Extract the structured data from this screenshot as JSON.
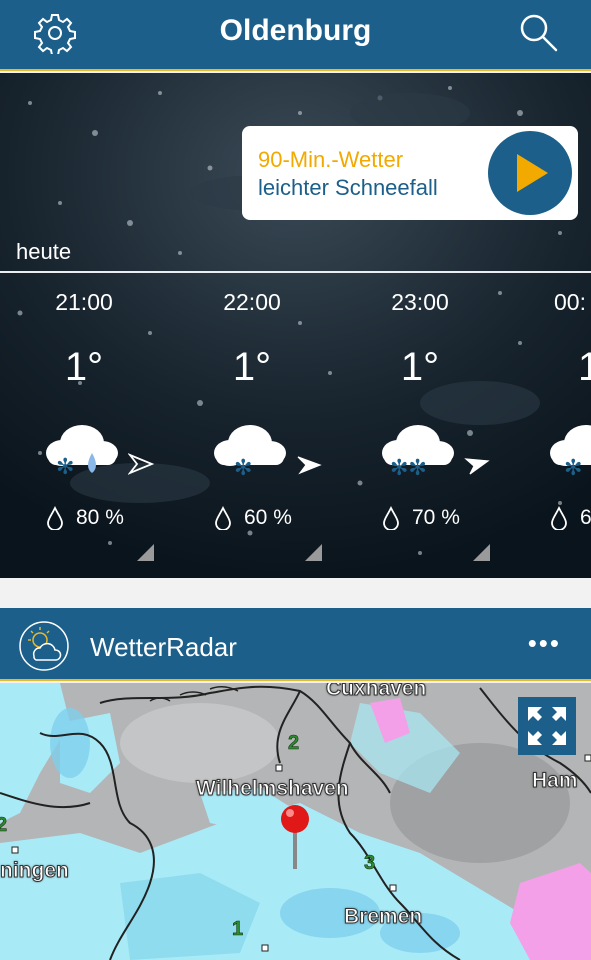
{
  "header": {
    "title": "Oldenburg",
    "settings_icon": "gear-icon",
    "search_icon": "search-icon"
  },
  "hero": {
    "today_label": "heute",
    "nowcast": {
      "line1": "90-Min.-Wetter",
      "line2": "leichter Schneefall",
      "play_icon": "play-icon"
    }
  },
  "hourly": [
    {
      "time": "21:00",
      "temp": "1°",
      "condition": "snow-rain-icon",
      "precip": "80 %"
    },
    {
      "time": "22:00",
      "temp": "1°",
      "condition": "light-snow-icon",
      "precip": "60 %"
    },
    {
      "time": "23:00",
      "temp": "1°",
      "condition": "snow-icon",
      "precip": "70 %"
    },
    {
      "time": "00:",
      "temp": "1",
      "condition": "snow-icon",
      "precip": "6"
    }
  ],
  "radar": {
    "title": "WetterRadar",
    "more_label": "•••",
    "cities": [
      "Cuxhaven",
      "Wilhelmshaven",
      "Ham",
      "ningen",
      "Bremen"
    ],
    "markers": [
      "2",
      "3",
      "1",
      "2"
    ]
  },
  "colors": {
    "header_bg": "#1b5f8a",
    "accent": "#e7b92f",
    "nowcast_orange": "#f2a900",
    "snow_blue": "#a9eaf7",
    "pink": "#f4a0e8"
  }
}
